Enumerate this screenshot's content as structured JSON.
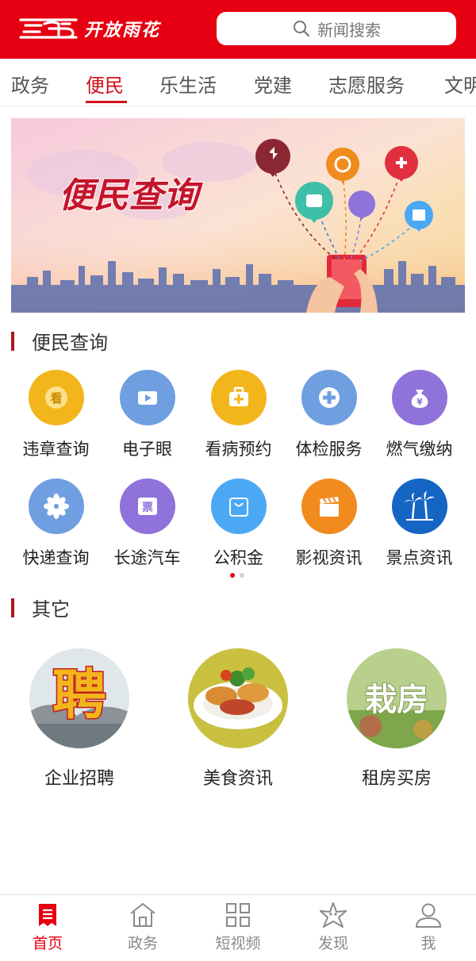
{
  "header": {
    "logo_text": "开放雨花",
    "search_placeholder": "新闻搜索"
  },
  "nav": {
    "tabs": [
      "政务",
      "便民",
      "乐生活",
      "党建",
      "志愿服务",
      "文明"
    ],
    "active_index": 1
  },
  "banner": {
    "title": "便民查询"
  },
  "services": {
    "section_title": "便民查询",
    "items": [
      {
        "label": "违章查询",
        "icon": "eye-badge-icon",
        "color": "#f3b51c"
      },
      {
        "label": "电子眼",
        "icon": "video-camera-icon",
        "color": "#6f9fe0"
      },
      {
        "label": "看病预约",
        "icon": "medical-kit-icon",
        "color": "#f3b51c"
      },
      {
        "label": "体检服务",
        "icon": "medical-cross-icon",
        "color": "#6f9fe0"
      },
      {
        "label": "燃气缴纳",
        "icon": "money-bag-icon",
        "color": "#8f72da"
      },
      {
        "label": "快递查询",
        "icon": "flower-icon",
        "color": "#6f9fe0"
      },
      {
        "label": "长途汽车",
        "icon": "ticket-icon",
        "color": "#8f72da"
      },
      {
        "label": "公积金",
        "icon": "shopping-bag-icon",
        "color": "#4aa8f5"
      },
      {
        "label": "影视资讯",
        "icon": "clapperboard-icon",
        "color": "#f18b1e"
      },
      {
        "label": "景点资讯",
        "icon": "palm-tree-icon",
        "color": "#1566c4"
      }
    ],
    "page_count": 2,
    "current_page": 1
  },
  "other": {
    "section_title": "其它",
    "items": [
      {
        "label": "企业招聘",
        "image_text": "聘"
      },
      {
        "label": "美食资讯",
        "image_text": ""
      },
      {
        "label": "租房买房",
        "image_text": "栽房"
      }
    ]
  },
  "bottom_tabs": [
    {
      "label": "首页",
      "icon": "news-icon",
      "active": true
    },
    {
      "label": "政务",
      "icon": "house-icon",
      "active": false
    },
    {
      "label": "短视频",
      "icon": "grid-icon",
      "active": false
    },
    {
      "label": "发现",
      "icon": "starfish-icon",
      "active": false
    },
    {
      "label": "我",
      "icon": "user-icon",
      "active": false
    }
  ],
  "colors": {
    "brand_red": "#e60012",
    "active_text": "#d0101c"
  }
}
